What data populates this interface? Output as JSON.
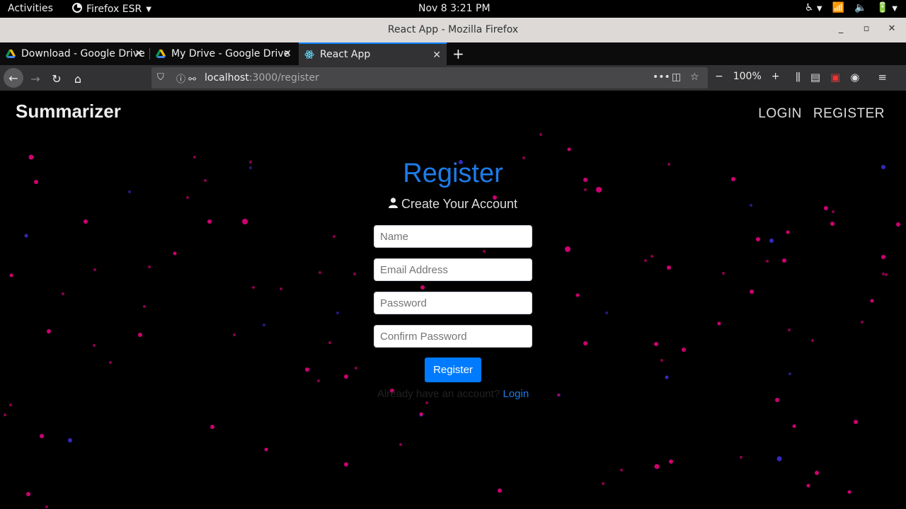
{
  "system": {
    "activities": "Activities",
    "app_name": "Firefox ESR",
    "clock": "Nov 8   3:21 PM"
  },
  "window": {
    "title": "React App - Mozilla Firefox"
  },
  "tabs": [
    {
      "label": "Download - Google Drive",
      "icon": "google-drive-icon"
    },
    {
      "label": "My Drive - Google Drive",
      "icon": "google-drive-icon"
    },
    {
      "label": "React App",
      "icon": "react-icon",
      "active": true
    }
  ],
  "urlbar": {
    "host": "localhost",
    "path": ":3000/register"
  },
  "zoom": "100%",
  "site": {
    "brand": "Summarizer",
    "nav": {
      "login": "LOGIN",
      "register": "REGISTER"
    }
  },
  "form": {
    "heading": "Register",
    "subtitle": "Create Your Account",
    "name_placeholder": "Name",
    "email_placeholder": "Email Address",
    "password_placeholder": "Password",
    "confirm_placeholder": "Confirm Password",
    "submit_label": "Register",
    "already_text": "Already have an account?",
    "login_link": "Login"
  },
  "colors": {
    "accent": "#007bff",
    "heading": "#1e7be8",
    "particle": "#e6007e",
    "particle_blue": "#3a2fd0"
  }
}
